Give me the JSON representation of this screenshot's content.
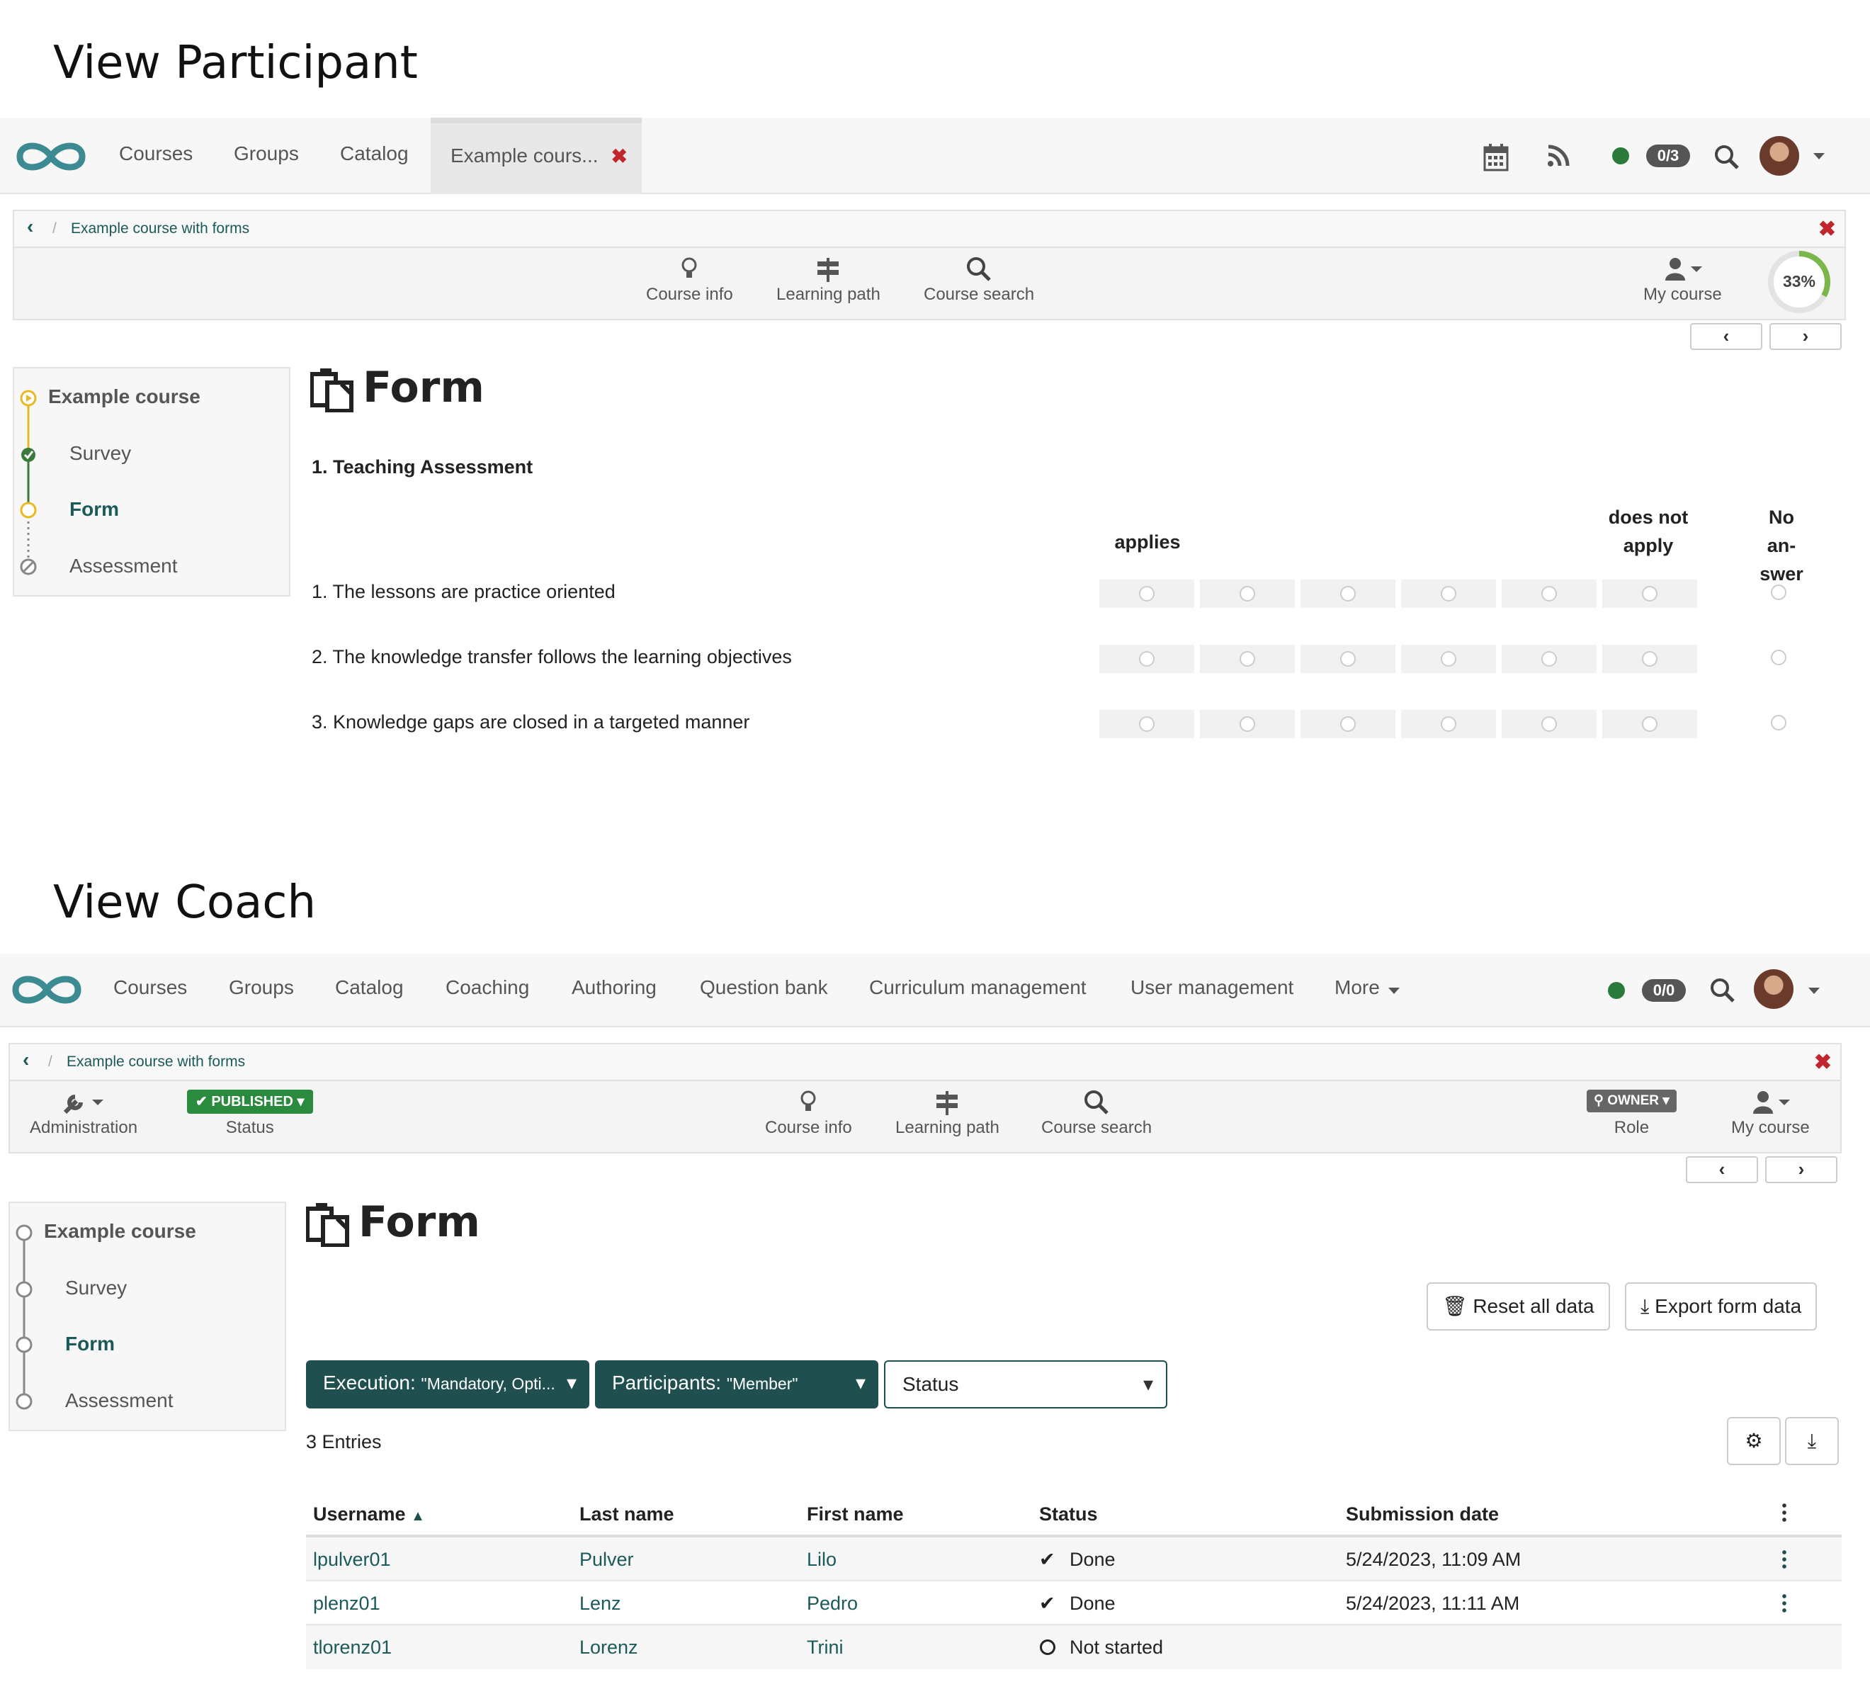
{
  "participant": {
    "section_title": "View Participant",
    "nav": {
      "links": [
        "Courses",
        "Groups",
        "Catalog"
      ],
      "tab_label": "Example cours...",
      "tab_close": "✖",
      "badge": "0/3"
    },
    "breadcrumb": {
      "back": "‹",
      "sep": "/",
      "course": "Example course with forms"
    },
    "toolbar": {
      "course_info": "Course info",
      "learning_path": "Learning path",
      "course_search": "Course search",
      "my_course": "My course",
      "progress": "33%"
    },
    "menu": {
      "root": "Example course",
      "items": [
        "Survey",
        "Form",
        "Assessment"
      ]
    },
    "form": {
      "title": "Form",
      "section": "1. Teaching Assessment",
      "col_applies": "applies",
      "col_not_apply": "does not apply",
      "col_no_answer": "No an- swer",
      "questions": [
        "1. The lessons are practice oriented",
        "2. The knowledge transfer follows the learning objectives",
        "3. Knowledge gaps are closed in a targeted manner"
      ]
    }
  },
  "coach": {
    "section_title": "View Coach",
    "nav": {
      "links": [
        "Courses",
        "Groups",
        "Catalog",
        "Coaching",
        "Authoring",
        "Question bank",
        "Curriculum management",
        "User management",
        "More"
      ],
      "badge": "0/0"
    },
    "breadcrumb": {
      "back": "‹",
      "sep": "/",
      "course": "Example course with forms"
    },
    "toolbar": {
      "administration": "Administration",
      "published": "PUBLISHED",
      "status": "Status",
      "course_info": "Course info",
      "learning_path": "Learning path",
      "course_search": "Course search",
      "owner": "OWNER",
      "role": "Role",
      "my_course": "My course"
    },
    "menu": {
      "root": "Example course",
      "items": [
        "Survey",
        "Form",
        "Assessment"
      ]
    },
    "form": {
      "title": "Form",
      "reset_button": "Reset all data",
      "export_button": "Export form data",
      "filters": {
        "execution_label": "Execution:",
        "execution_value": "\"Mandatory, Opti...",
        "participants_label": "Participants:",
        "participants_value": "\"Member\"",
        "status_label": "Status"
      },
      "entries": "3 Entries",
      "columns": [
        "Username",
        "Last name",
        "First name",
        "Status",
        "Submission date"
      ],
      "rows": [
        {
          "username": "lpulver01",
          "last": "Pulver",
          "first": "Lilo",
          "status": "Done",
          "date": "5/24/2023, 11:09 AM"
        },
        {
          "username": "plenz01",
          "last": "Lenz",
          "first": "Pedro",
          "status": "Done",
          "date": "5/24/2023, 11:11 AM"
        },
        {
          "username": "tlorenz01",
          "last": "Lorenz",
          "first": "Trini",
          "status": "Not started",
          "date": ""
        }
      ]
    }
  },
  "colors": {
    "accent": "#1c5a5a",
    "success": "#2a7a3b",
    "close": "#c0262c",
    "progress": "#7ab648"
  }
}
